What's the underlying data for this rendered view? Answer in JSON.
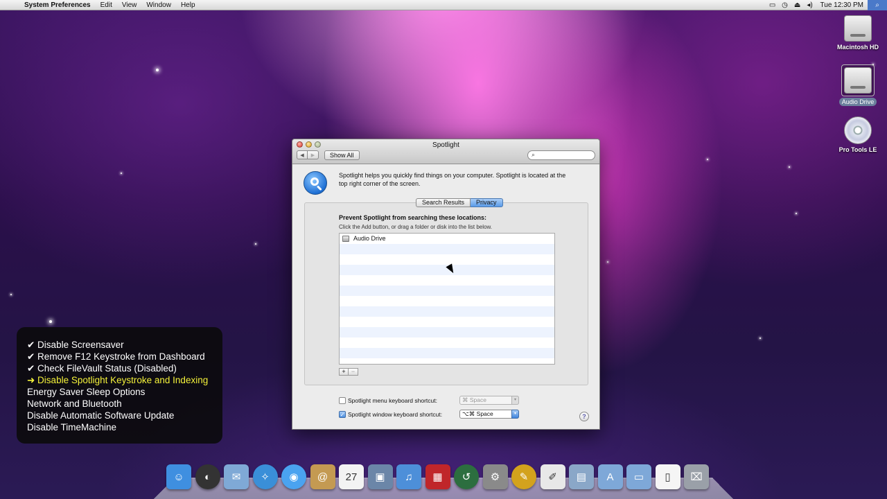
{
  "menubar": {
    "apple_icon": "",
    "app_name": "System Preferences",
    "items": [
      "Edit",
      "View",
      "Window",
      "Help"
    ],
    "status_icons": [
      "airplay-icon",
      "time-machine-icon",
      "eject-icon",
      "volume-icon"
    ],
    "clock": "Tue 12:30 PM",
    "search_icon": "⌕"
  },
  "desktop": {
    "icons": [
      {
        "label": "Macintosh HD"
      },
      {
        "label": "Audio Drive"
      },
      {
        "label": "Pro Tools LE"
      }
    ]
  },
  "window": {
    "title": "Spotlight",
    "back": "◀",
    "forward": "▶",
    "show_all": "Show All",
    "search_placeholder": "",
    "intro": "Spotlight helps you quickly find things on your computer. Spotlight is located at the top right corner of the screen.",
    "tabs": [
      {
        "label": "Search Results",
        "active": false
      },
      {
        "label": "Privacy",
        "active": true
      }
    ],
    "prevent_heading": "Prevent Spotlight from searching these locations:",
    "prevent_hint": "Click the Add button, or drag a folder or disk into the list below.",
    "excluded": [
      "Audio Drive"
    ],
    "add_label": "+",
    "remove_label": "−",
    "shortcuts": [
      {
        "label": "Spotlight menu keyboard shortcut:",
        "checked": false,
        "check_mark": "",
        "value": "⌘ Space",
        "arrow": "▾"
      },
      {
        "label": "Spotlight window keyboard shortcut:",
        "checked": true,
        "check_mark": "✓",
        "value": "⌥⌘ Space",
        "arrow": "▾"
      }
    ],
    "help": "?"
  },
  "checklist": [
    {
      "text": "✔ Disable Screensaver",
      "state": "done"
    },
    {
      "text": "✔ Remove F12 Keystroke from Dashboard",
      "state": "done"
    },
    {
      "text": "✔ Check FileVault Status (Disabled)",
      "state": "done"
    },
    {
      "text": "➜ Disable Spotlight Keystroke and Indexing",
      "state": "current"
    },
    {
      "text": "Energy Saver Sleep Options",
      "state": "todo"
    },
    {
      "text": "Network and Bluetooth",
      "state": "todo"
    },
    {
      "text": "Disable Automatic Software Update",
      "state": "todo"
    },
    {
      "text": "Disable TimeMachine",
      "state": "todo"
    }
  ],
  "dock": [
    {
      "name": "finder-icon",
      "color": "#3f8fe0",
      "glyph": "☺"
    },
    {
      "name": "dashboard-icon",
      "color": "#333333",
      "glyph": "◐"
    },
    {
      "name": "mail-icon",
      "color": "#7fa9d6",
      "glyph": "✉"
    },
    {
      "name": "safari-icon",
      "color": "#3a8fd8",
      "glyph": "✧"
    },
    {
      "name": "ichat-icon",
      "color": "#4aa3f0",
      "glyph": "◉"
    },
    {
      "name": "address-book-icon",
      "color": "#c49a52",
      "glyph": "@"
    },
    {
      "name": "ical-icon",
      "color": "#f3f3f3",
      "glyph": "27"
    },
    {
      "name": "iphoto-icon",
      "color": "#6b86a8",
      "glyph": "▣"
    },
    {
      "name": "itunes-icon",
      "color": "#4d8fd9",
      "glyph": "♫"
    },
    {
      "name": "photo-booth-icon",
      "color": "#c0262a",
      "glyph": "▦"
    },
    {
      "name": "time-machine-icon",
      "color": "#2c6e3f",
      "glyph": "↺"
    },
    {
      "name": "system-preferences-icon",
      "color": "#8a8a8a",
      "glyph": "⚙"
    },
    {
      "name": "garageband-icon",
      "color": "#d3a21d",
      "glyph": "✎"
    },
    {
      "name": "preview-icon",
      "color": "#e8e8e8",
      "glyph": "✐"
    },
    {
      "name": "iphoto-slideshow-icon",
      "color": "#8aa7c8",
      "glyph": "▤"
    },
    {
      "name": "applications-folder-icon",
      "color": "#7ea8d8",
      "glyph": "A"
    },
    {
      "name": "documents-folder-icon",
      "color": "#7ea8d8",
      "glyph": "▭"
    },
    {
      "name": "document-icon",
      "color": "#f5f5f5",
      "glyph": "▯"
    },
    {
      "name": "trash-icon",
      "color": "#9aa0a8",
      "glyph": "⌧"
    }
  ]
}
